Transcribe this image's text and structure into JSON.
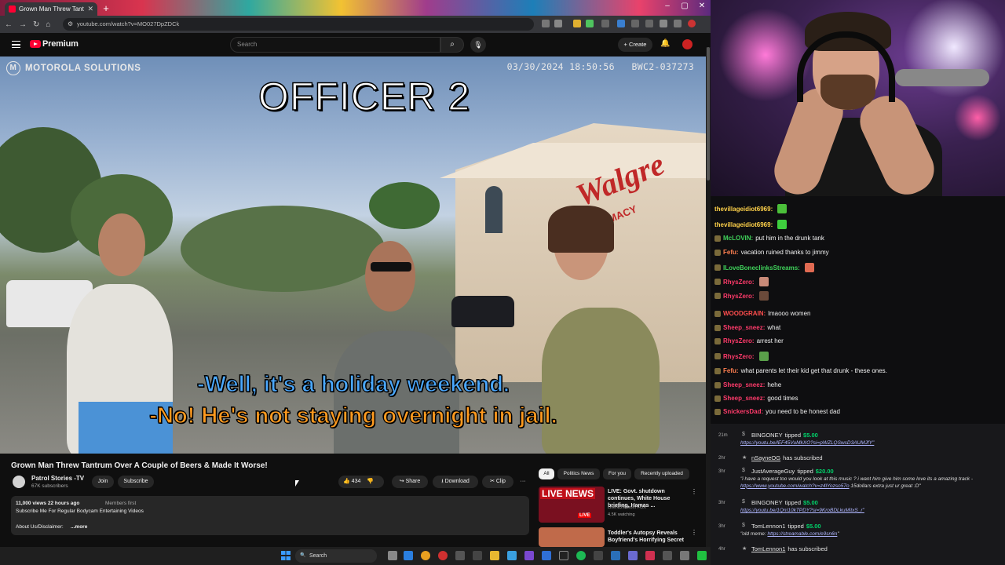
{
  "browser": {
    "tab_title": "Grown Man Threw Tantrum",
    "url": "youtube.com/watch?v=MO027DpZDCk",
    "new_tab": "+"
  },
  "youtube": {
    "premium_label": "Premium",
    "search_placeholder": "Search",
    "create_label": "Create",
    "video": {
      "brand": "MOTOROLA SOLUTIONS",
      "timestamp": "03/30/2024 18:50:56",
      "camera_id": "BWC2-037273",
      "overlay_title": "OFFICER 2",
      "subtitle_1": "-Well, it's a holiday weekend.",
      "subtitle_2": "-No! He's not staying overnight in jail."
    },
    "title": "Grown Man Threw Tantrum Over A Couple of Beers & Made It Worse!",
    "channel": {
      "name": "Patrol Stories -TV",
      "subscribers": "67K subscribers",
      "join": "Join",
      "subscribe": "Subscribe"
    },
    "actions": {
      "likes": "434",
      "share": "Share",
      "download": "Download",
      "clip": "Clip",
      "more": "···"
    },
    "description": {
      "stats": "11,000 views  22 hours ago",
      "members": "Members first",
      "line1": "Subscribe Me For Regular Bodycam Entertaining Videos",
      "line2": "About Us/Disclaimer:",
      "more": "...more"
    },
    "chips": [
      "All",
      "Politics News",
      "For you",
      "Recently uploaded"
    ],
    "recommendations": [
      {
        "thumb_text": "LIVE NEWS",
        "title": "LIVE: Govt. shutdown continues, White House briefing, Hamas ...",
        "channel": "LiveNOW from FOX",
        "meta": "4.5K watching",
        "badge": "LIVE",
        "thumb_color": "#7a1020"
      },
      {
        "thumb_text": "",
        "title": "Toddler's Autopsy Reveals Boyfriend's Horrifying Secret",
        "channel": "",
        "meta": "",
        "badge": "",
        "thumb_color": "#c06a4a"
      }
    ]
  },
  "chat": {
    "messages": [
      {
        "user": "thevillageidiot6969:",
        "text": "",
        "color": "#ffd24a",
        "emote": "#4bbf3a"
      },
      {
        "user": "thevillageidiot6969:",
        "text": "",
        "color": "#ffd24a",
        "emote": "#3ecf3e"
      },
      {
        "user": "McLOVIN:",
        "text": "put him in the drunk tank",
        "color": "#3fd25a",
        "emote": ""
      },
      {
        "user": "Fefu:",
        "text": "vacation ruined thanks to jimmy",
        "color": "#ff7f50",
        "emote": ""
      },
      {
        "user": "ILoveBoneclinksStreams:",
        "text": "",
        "color": "#3fd25a",
        "emote": "#e06a52"
      },
      {
        "user": "RhysZero:",
        "text": "",
        "color": "#ff3b6b",
        "emote": "#c98a78"
      },
      {
        "user": "RhysZero:",
        "text": "",
        "color": "#ff3b6b",
        "emote": "#6b4a3a"
      },
      {
        "user": "WOODGRAIN:",
        "text": "lmaooo women",
        "color": "#ff4d4d",
        "emote": ""
      },
      {
        "user": "Sheep_sneez:",
        "text": "what",
        "color": "#ff3b6b",
        "emote": ""
      },
      {
        "user": "RhysZero:",
        "text": "arrest her",
        "color": "#ff3b6b",
        "emote": ""
      },
      {
        "user": "RhysZero:",
        "text": "",
        "color": "#ff3b6b",
        "emote": "#5aa04a"
      },
      {
        "user": "Fefu:",
        "text": "what parents let their kid get that drunk - these ones.",
        "color": "#ff7f50",
        "emote": ""
      },
      {
        "user": "Sheep_sneez:",
        "text": "hehe",
        "color": "#ff3b6b",
        "emote": ""
      },
      {
        "user": "Sheep_sneez:",
        "text": "good times",
        "color": "#ff3b6b",
        "emote": ""
      },
      {
        "user": "SnickersDad:",
        "text": "you need to be honest dad",
        "color": "#ff3b6b",
        "emote": ""
      }
    ]
  },
  "events": [
    {
      "time": "21m",
      "user": "BINGONEY",
      "action": "tipped",
      "amount": "$5.00",
      "subscribed": false,
      "body": "",
      "link": "https://youtu.be/lEF45VuMkXO?si=pWZLQSwsD3AUMJfY\""
    },
    {
      "time": "2hr",
      "user": "nSayneOG",
      "action": "has subscribed",
      "amount": "",
      "subscribed": true,
      "body": "",
      "link": ""
    },
    {
      "time": "3hr",
      "user": "JustAverageGuy",
      "action": "tipped",
      "amount": "$20.00",
      "subscribed": false,
      "body": "\"i have a request too would you look at this music ? i want him give him some love its a amazing track - ",
      "link": "https://www.youtube.com/watch?v=z4lYozso57o",
      "tail": " 15dollars extra just ur great :D\""
    },
    {
      "time": "3hr",
      "user": "BINGONEY",
      "action": "tipped",
      "amount": "$5.00",
      "subscribed": false,
      "body": "",
      "link": "https://youtu.be/1QnI10kTPDY?si=9KroBDLkuMitxS_r\""
    },
    {
      "time": "3hr",
      "user": "TomLennon1",
      "action": "tipped",
      "amount": "$5.00",
      "subscribed": false,
      "body": "\"old meme: ",
      "link": "https://streamable.com/e9sn6n",
      "tail": "\""
    },
    {
      "time": "4hr",
      "user": "TomLennon1",
      "action": "has subscribed",
      "amount": "",
      "subscribed": true,
      "body": "",
      "link": ""
    }
  ],
  "taskbar": {
    "search_label": "Search"
  },
  "colors": {
    "youtube_red": "#ff0033",
    "tip_green": "#00d26a",
    "subtitle_blue": "#4aa8ff",
    "subtitle_orange": "#ff9a1f"
  }
}
